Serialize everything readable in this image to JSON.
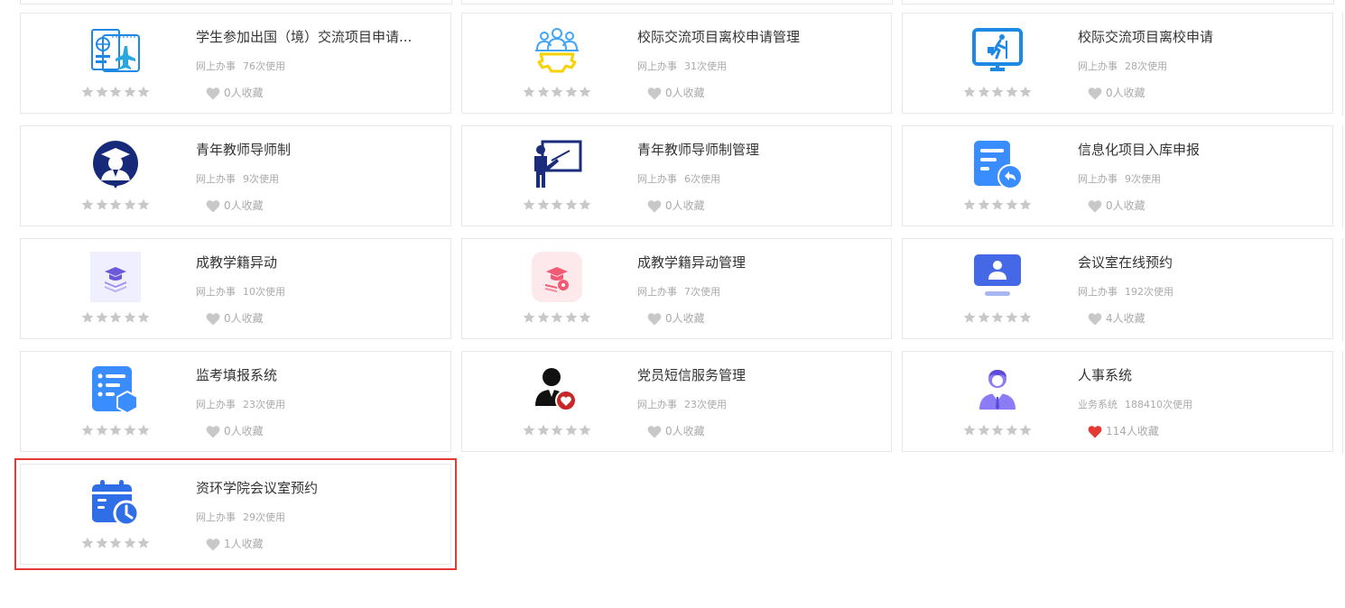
{
  "colors": {
    "star": "#c8c8c8",
    "heart_off": "#c8c8c8",
    "heart_on": "#e53935",
    "highlight": "#e53935"
  },
  "cards": [
    {
      "title": "学生参加出国（境）交流项目申请...",
      "category": "网上办事",
      "uses": "76次使用",
      "favorites": "0人收藏",
      "icon": "passport-plane-icon",
      "favorited": false,
      "highlighted": false
    },
    {
      "title": "校际交流项目离校申请管理",
      "category": "网上办事",
      "uses": "31次使用",
      "favorites": "0人收藏",
      "icon": "team-gear-icon",
      "favorited": false,
      "highlighted": false
    },
    {
      "title": "校际交流项目离校申请",
      "category": "网上办事",
      "uses": "28次使用",
      "favorites": "0人收藏",
      "icon": "monitor-walker-icon",
      "favorited": false,
      "highlighted": false
    },
    {
      "title": "青年教师导师制",
      "category": "网上办事",
      "uses": "9次使用",
      "favorites": "0人收藏",
      "icon": "graduate-badge-icon",
      "favorited": false,
      "highlighted": false
    },
    {
      "title": "青年教师导师制管理",
      "category": "网上办事",
      "uses": "6次使用",
      "favorites": "0人收藏",
      "icon": "teacher-board-icon",
      "favorited": false,
      "highlighted": false
    },
    {
      "title": "信息化项目入库申报",
      "category": "网上办事",
      "uses": "9次使用",
      "favorites": "0人收藏",
      "icon": "document-return-icon",
      "favorited": false,
      "highlighted": false
    },
    {
      "title": "成教学籍异动",
      "category": "网上办事",
      "uses": "10次使用",
      "favorites": "0人收藏",
      "icon": "graduation-cap-books-icon",
      "favorited": false,
      "highlighted": false
    },
    {
      "title": "成教学籍异动管理",
      "category": "网上办事",
      "uses": "7次使用",
      "favorites": "0人收藏",
      "icon": "graduation-cap-settings-icon",
      "favorited": false,
      "highlighted": false
    },
    {
      "title": "会议室在线预约",
      "category": "网上办事",
      "uses": "192次使用",
      "favorites": "4人收藏",
      "icon": "monitor-user-icon",
      "favorited": false,
      "highlighted": false
    },
    {
      "title": "监考填报系统",
      "category": "网上办事",
      "uses": "23次使用",
      "favorites": "0人收藏",
      "icon": "form-hexagon-icon",
      "favorited": false,
      "highlighted": false
    },
    {
      "title": "党员短信服务管理",
      "category": "网上办事",
      "uses": "23次使用",
      "favorites": "0人收藏",
      "icon": "person-heart-icon",
      "favorited": false,
      "highlighted": false
    },
    {
      "title": "人事系统",
      "category": "业务系统",
      "uses": "188410次使用",
      "favorites": "114人收藏",
      "icon": "businessman-icon",
      "favorited": true,
      "highlighted": false
    },
    {
      "title": "资环学院会议室预约",
      "category": "网上办事",
      "uses": "29次使用",
      "favorites": "1人收藏",
      "icon": "calendar-clock-icon",
      "favorited": false,
      "highlighted": true
    }
  ]
}
